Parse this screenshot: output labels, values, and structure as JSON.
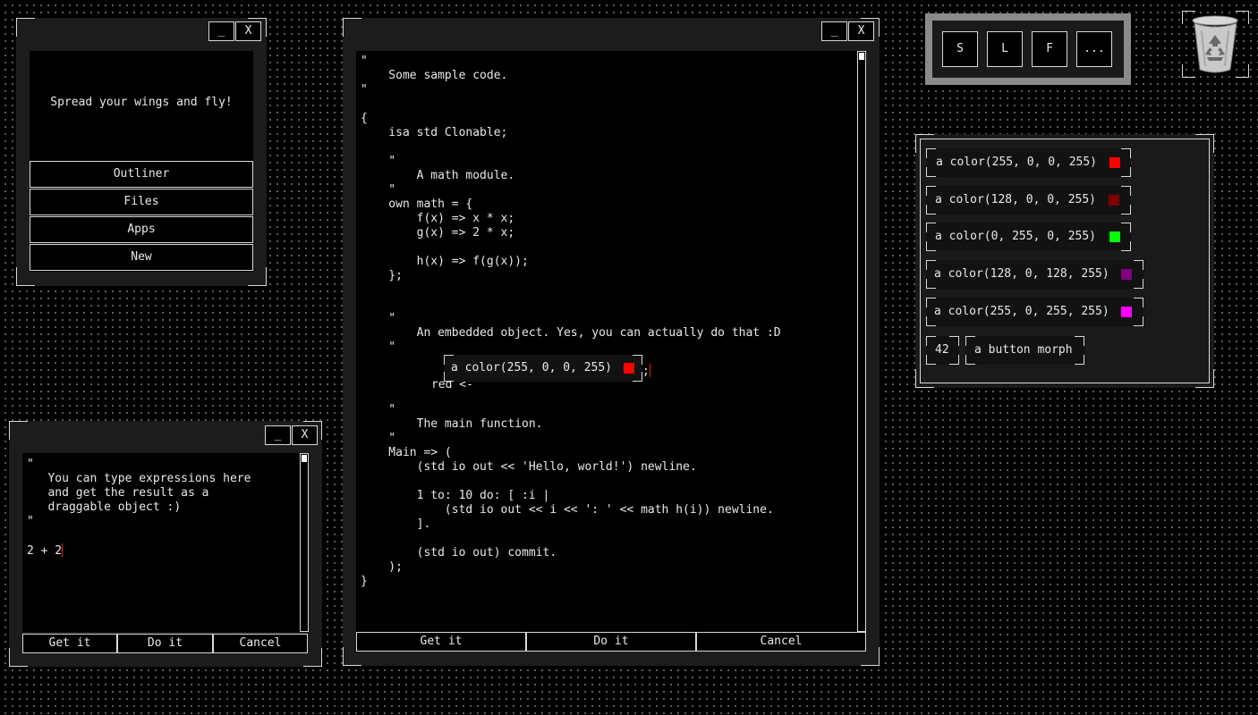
{
  "window_controls": {
    "minimize": "_",
    "close": "X"
  },
  "launcher": {
    "message": "Spread your wings and fly!",
    "menu": [
      "Outliner",
      "Files",
      "Apps",
      "New"
    ]
  },
  "evaluator": {
    "code_lines": [
      "\"",
      "   You can type expressions here",
      "   and get the result as a",
      "   draggable object :)",
      "\""
    ],
    "input": "2 + 2",
    "buttons": {
      "get": "Get it",
      "do": "Do it",
      "cancel": "Cancel"
    }
  },
  "editor": {
    "code_before": [
      "\"",
      "    Some sample code.",
      "\"",
      "",
      "{",
      "    isa std Clonable;",
      "",
      "    \"",
      "        A math module.",
      "    \"",
      "    own math = {",
      "        f(x) => x * x;",
      "        g(x) => 2 * x;",
      "",
      "        h(x) => f(g(x));",
      "    };",
      "",
      "",
      "    \"",
      "        An embedded object. Yes, you can actually do that :D",
      "    \""
    ],
    "red_prefix": "red <-",
    "embedded_label": "a color(255, 0, 0, 255)",
    "embedded_color": "#ff0000",
    "red_suffix": ";",
    "code_after": [
      "",
      "    \"",
      "        The main function.",
      "    \"",
      "    Main => (",
      "        (std io out << 'Hello, world!') newline.",
      "",
      "        1 to: 10 do: [ :i |",
      "            (std io out << i << ': ' << math h(i)) newline.",
      "        ].",
      "",
      "        (std io out) commit.",
      "    );",
      "}"
    ],
    "buttons": {
      "get": "Get it",
      "do": "Do it",
      "cancel": "Cancel"
    }
  },
  "toolbar": {
    "buttons": [
      "S",
      "L",
      "F",
      "..."
    ]
  },
  "trash": {
    "icon": "recycle-bin-icon"
  },
  "morph_list": {
    "colors": [
      {
        "label": "a color(255, 0, 0, 255)",
        "color": "#ff0000"
      },
      {
        "label": "a color(128, 0, 0, 255)",
        "color": "#800000"
      },
      {
        "label": "a color(0, 255, 0, 255)",
        "color": "#00ff00"
      },
      {
        "label": "a color(128, 0, 128, 255)",
        "color": "#800080"
      },
      {
        "label": "a color(255, 0, 255, 255)",
        "color": "#ff00ff"
      }
    ],
    "number": "42",
    "button_morph": "a button morph"
  }
}
